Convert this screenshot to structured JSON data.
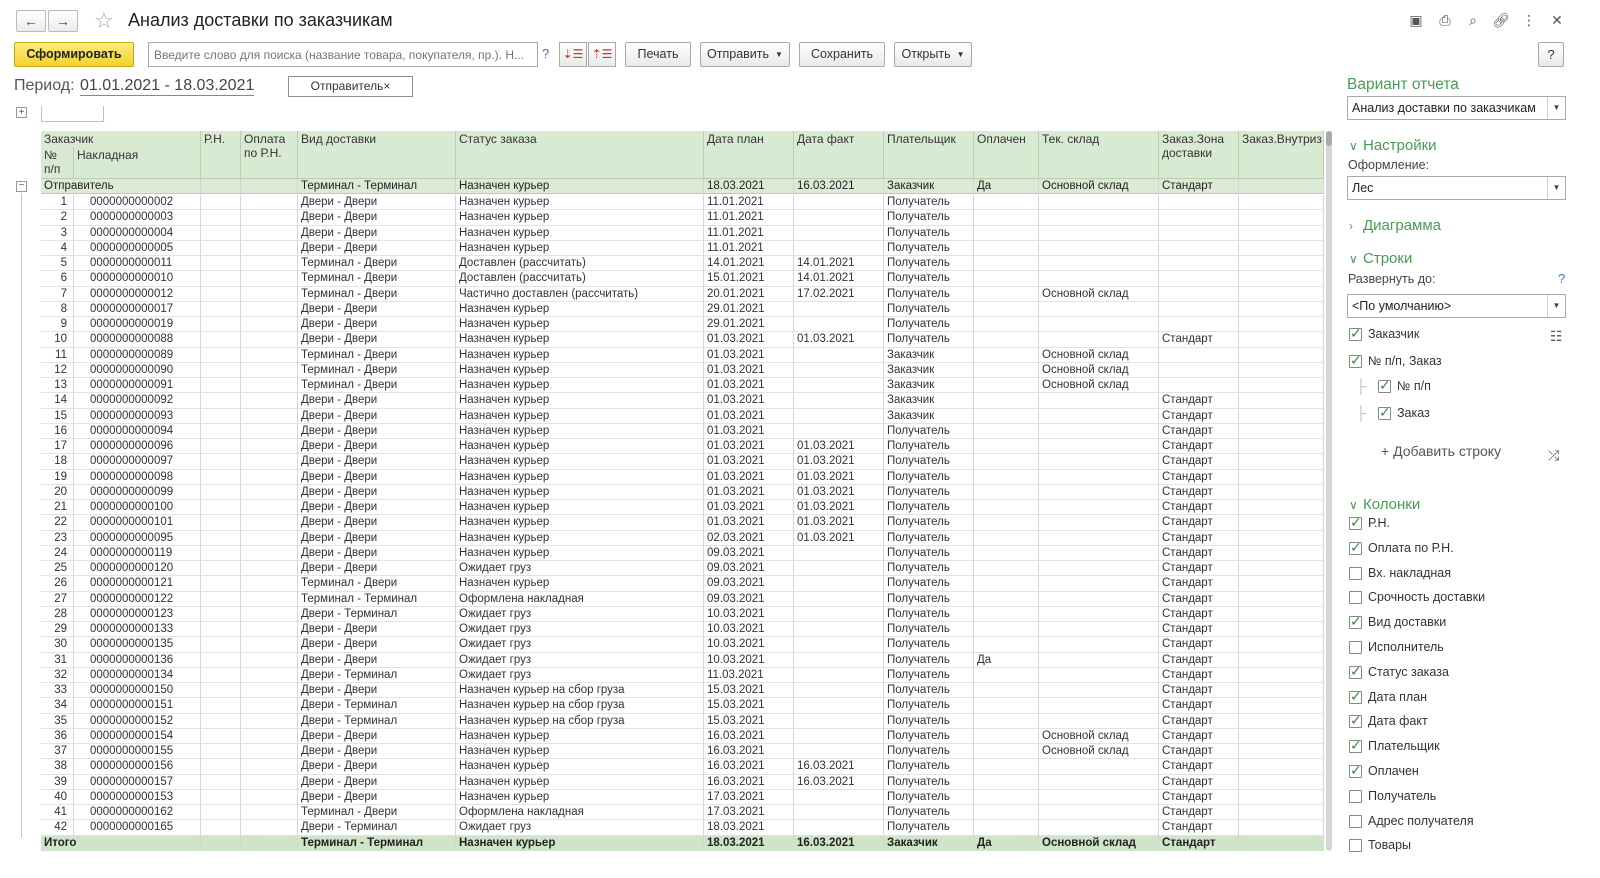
{
  "window": {
    "title": "Анализ доставки по заказчикам"
  },
  "toolbar": {
    "generate_label": "Сформировать",
    "search_placeholder": "Введите слово для поиска (название товара, покупателя, пр.). Н...",
    "help_mark": "?",
    "print_label": "Печать",
    "send_label": "Отправить",
    "save_label": "Сохранить",
    "open_label": "Открыть",
    "help_label": "?"
  },
  "header_icons": [
    "save-icon",
    "print-icon",
    "preview-icon",
    "link-icon",
    "more-icon",
    "close-icon"
  ],
  "period": {
    "label": "Период:",
    "value": "01.01.2021 - 18.03.2021"
  },
  "filter_chip": {
    "label": "Отправитель×"
  },
  "report": {
    "columns": {
      "customer": "Заказчик",
      "num": "№ п/п",
      "waybill": "Накладная",
      "rn": "Р.Н.",
      "pay_rn": "Оплата по Р.Н.",
      "delivery_type": "Вид доставки",
      "order_status": "Статус заказа",
      "date_plan": "Дата план",
      "date_fact": "Дата факт",
      "payer": "Плательщик",
      "paid": "Оплачен",
      "warehouse": "Тек. склад",
      "zone": "Заказ.Зона доставки",
      "inner": "Заказ.Внутриз коэфициент"
    },
    "group": {
      "name": "Отправитель",
      "delivery_type": "Терминал - Терминал",
      "order_status": "Назначен курьер",
      "date_plan": "18.03.2021",
      "date_fact": "16.03.2021",
      "payer": "Заказчик",
      "paid": "Да",
      "warehouse": "Основной склад",
      "zone": "Стандарт"
    },
    "rows": [
      [
        "1",
        "0000000000002",
        "Двери - Двери",
        "Назначен курьер",
        "11.01.2021",
        "",
        "Получатель",
        "",
        "",
        ""
      ],
      [
        "2",
        "0000000000003",
        "Двери - Двери",
        "Назначен курьер",
        "11.01.2021",
        "",
        "Получатель",
        "",
        "",
        ""
      ],
      [
        "3",
        "0000000000004",
        "Двери - Двери",
        "Назначен курьер",
        "11.01.2021",
        "",
        "Получатель",
        "",
        "",
        ""
      ],
      [
        "4",
        "0000000000005",
        "Двери - Двери",
        "Назначен курьер",
        "11.01.2021",
        "",
        "Получатель",
        "",
        "",
        ""
      ],
      [
        "5",
        "0000000000011",
        "Терминал - Двери",
        "Доставлен (рассчитать)",
        "14.01.2021",
        "14.01.2021",
        "Получатель",
        "",
        "",
        ""
      ],
      [
        "6",
        "0000000000010",
        "Терминал - Двери",
        "Доставлен (рассчитать)",
        "15.01.2021",
        "14.01.2021",
        "Получатель",
        "",
        "",
        ""
      ],
      [
        "7",
        "0000000000012",
        "Терминал - Двери",
        "Частично доставлен (рассчитать)",
        "20.01.2021",
        "17.02.2021",
        "Получатель",
        "",
        "Основной склад",
        ""
      ],
      [
        "8",
        "0000000000017",
        "Двери - Двери",
        "Назначен курьер",
        "29.01.2021",
        "",
        "Получатель",
        "",
        "",
        ""
      ],
      [
        "9",
        "0000000000019",
        "Двери - Двери",
        "Назначен курьер",
        "29.01.2021",
        "",
        "Получатель",
        "",
        "",
        ""
      ],
      [
        "10",
        "0000000000088",
        "Двери - Двери",
        "Назначен курьер",
        "01.03.2021",
        "01.03.2021",
        "Получатель",
        "",
        "",
        "Стандарт"
      ],
      [
        "11",
        "0000000000089",
        "Терминал - Двери",
        "Назначен курьер",
        "01.03.2021",
        "",
        "Заказчик",
        "",
        "Основной склад",
        ""
      ],
      [
        "12",
        "0000000000090",
        "Терминал - Двери",
        "Назначен курьер",
        "01.03.2021",
        "",
        "Заказчик",
        "",
        "Основной склад",
        ""
      ],
      [
        "13",
        "0000000000091",
        "Терминал - Двери",
        "Назначен курьер",
        "01.03.2021",
        "",
        "Заказчик",
        "",
        "Основной склад",
        ""
      ],
      [
        "14",
        "0000000000092",
        "Двери - Двери",
        "Назначен курьер",
        "01.03.2021",
        "",
        "Заказчик",
        "",
        "",
        "Стандарт"
      ],
      [
        "15",
        "0000000000093",
        "Двери - Двери",
        "Назначен курьер",
        "01.03.2021",
        "",
        "Заказчик",
        "",
        "",
        "Стандарт"
      ],
      [
        "16",
        "0000000000094",
        "Двери - Двери",
        "Назначен курьер",
        "01.03.2021",
        "",
        "Получатель",
        "",
        "",
        "Стандарт"
      ],
      [
        "17",
        "0000000000096",
        "Двери - Двери",
        "Назначен курьер",
        "01.03.2021",
        "01.03.2021",
        "Получатель",
        "",
        "",
        "Стандарт"
      ],
      [
        "18",
        "0000000000097",
        "Двери - Двери",
        "Назначен курьер",
        "01.03.2021",
        "01.03.2021",
        "Получатель",
        "",
        "",
        "Стандарт"
      ],
      [
        "19",
        "0000000000098",
        "Двери - Двери",
        "Назначен курьер",
        "01.03.2021",
        "01.03.2021",
        "Получатель",
        "",
        "",
        "Стандарт"
      ],
      [
        "20",
        "0000000000099",
        "Двери - Двери",
        "Назначен курьер",
        "01.03.2021",
        "01.03.2021",
        "Получатель",
        "",
        "",
        "Стандарт"
      ],
      [
        "21",
        "0000000000100",
        "Двери - Двери",
        "Назначен курьер",
        "01.03.2021",
        "01.03.2021",
        "Получатель",
        "",
        "",
        "Стандарт"
      ],
      [
        "22",
        "0000000000101",
        "Двери - Двери",
        "Назначен курьер",
        "01.03.2021",
        "01.03.2021",
        "Получатель",
        "",
        "",
        "Стандарт"
      ],
      [
        "23",
        "0000000000095",
        "Двери - Двери",
        "Назначен курьер",
        "02.03.2021",
        "01.03.2021",
        "Получатель",
        "",
        "",
        "Стандарт"
      ],
      [
        "24",
        "0000000000119",
        "Двери - Двери",
        "Назначен курьер",
        "09.03.2021",
        "",
        "Получатель",
        "",
        "",
        "Стандарт"
      ],
      [
        "25",
        "0000000000120",
        "Двери - Двери",
        "Ожидает груз",
        "09.03.2021",
        "",
        "Получатель",
        "",
        "",
        "Стандарт"
      ],
      [
        "26",
        "0000000000121",
        "Терминал - Двери",
        "Назначен курьер",
        "09.03.2021",
        "",
        "Получатель",
        "",
        "",
        "Стандарт"
      ],
      [
        "27",
        "0000000000122",
        "Терминал - Терминал",
        "Оформлена накладная",
        "09.03.2021",
        "",
        "Получатель",
        "",
        "",
        "Стандарт"
      ],
      [
        "28",
        "0000000000123",
        "Двери - Терминал",
        "Ожидает груз",
        "10.03.2021",
        "",
        "Получатель",
        "",
        "",
        "Стандарт"
      ],
      [
        "29",
        "0000000000133",
        "Двери - Двери",
        "Ожидает груз",
        "10.03.2021",
        "",
        "Получатель",
        "",
        "",
        "Стандарт"
      ],
      [
        "30",
        "0000000000135",
        "Двери - Двери",
        "Ожидает груз",
        "10.03.2021",
        "",
        "Получатель",
        "",
        "",
        "Стандарт"
      ],
      [
        "31",
        "0000000000136",
        "Двери - Двери",
        "Ожидает груз",
        "10.03.2021",
        "",
        "Получатель",
        "Да",
        "",
        "Стандарт"
      ],
      [
        "32",
        "0000000000134",
        "Двери - Терминал",
        "Ожидает груз",
        "11.03.2021",
        "",
        "Получатель",
        "",
        "",
        "Стандарт"
      ],
      [
        "33",
        "0000000000150",
        "Двери - Двери",
        "Назначен курьер на сбор груза",
        "15.03.2021",
        "",
        "Получатель",
        "",
        "",
        "Стандарт"
      ],
      [
        "34",
        "0000000000151",
        "Двери - Терминал",
        "Назначен курьер на сбор груза",
        "15.03.2021",
        "",
        "Получатель",
        "",
        "",
        "Стандарт"
      ],
      [
        "35",
        "0000000000152",
        "Двери - Терминал",
        "Назначен курьер на сбор груза",
        "15.03.2021",
        "",
        "Получатель",
        "",
        "",
        "Стандарт"
      ],
      [
        "36",
        "0000000000154",
        "Двери - Двери",
        "Назначен курьер",
        "16.03.2021",
        "",
        "Получатель",
        "",
        "Основной склад",
        "Стандарт"
      ],
      [
        "37",
        "0000000000155",
        "Двери - Двери",
        "Назначен курьер",
        "16.03.2021",
        "",
        "Получатель",
        "",
        "Основной склад",
        "Стандарт"
      ],
      [
        "38",
        "0000000000156",
        "Двери - Двери",
        "Назначен курьер",
        "16.03.2021",
        "16.03.2021",
        "Получатель",
        "",
        "",
        "Стандарт"
      ],
      [
        "39",
        "0000000000157",
        "Двери - Двери",
        "Назначен курьер",
        "16.03.2021",
        "16.03.2021",
        "Получатель",
        "",
        "",
        "Стандарт"
      ],
      [
        "40",
        "0000000000153",
        "Двери - Двери",
        "Назначен курьер",
        "17.03.2021",
        "",
        "Получатель",
        "",
        "",
        "Стандарт"
      ],
      [
        "41",
        "0000000000162",
        "Терминал - Двери",
        "Оформлена накладная",
        "17.03.2021",
        "",
        "Получатель",
        "",
        "",
        "Стандарт"
      ],
      [
        "42",
        "0000000000165",
        "Двери - Терминал",
        "Ожидает груз",
        "18.03.2021",
        "",
        "Получатель",
        "",
        "",
        "Стандарт"
      ]
    ],
    "total": {
      "label": "Итого",
      "delivery_type": "Терминал - Терминал",
      "order_status": "Назначен курьер",
      "date_plan": "18.03.2021",
      "date_fact": "16.03.2021",
      "payer": "Заказчик",
      "paid": "Да",
      "warehouse": "Основной склад",
      "zone": "Стандарт"
    }
  },
  "panel": {
    "variant_title": "Вариант отчета",
    "variant_value": "Анализ доставки по заказчикам",
    "settings_title": "Настройки",
    "design_label": "Оформление:",
    "design_value": "Лес",
    "diagram_title": "Диаграмма",
    "rows_title": "Строки",
    "expand_label": "Развернуть до:",
    "expand_help": "?",
    "expand_value": "<По умолчанию>",
    "row_items": [
      {
        "label": "Заказчик",
        "checked": true
      },
      {
        "label": "№ п/п, Заказ",
        "checked": true
      },
      {
        "label": "№ п/п",
        "checked": true
      },
      {
        "label": "Заказ",
        "checked": true
      }
    ],
    "add_row": "+ Добавить строку",
    "columns_title": "Колонки",
    "column_items": [
      {
        "label": "Р.Н.",
        "checked": true
      },
      {
        "label": "Оплата по Р.Н.",
        "checked": true
      },
      {
        "label": "Вх. накладная",
        "checked": false
      },
      {
        "label": "Срочность доставки",
        "checked": false
      },
      {
        "label": "Вид доставки",
        "checked": true
      },
      {
        "label": "Исполнитель",
        "checked": false
      },
      {
        "label": "Статус заказа",
        "checked": true
      },
      {
        "label": "Дата план",
        "checked": true
      },
      {
        "label": "Дата факт",
        "checked": true
      },
      {
        "label": "Плательщик",
        "checked": true
      },
      {
        "label": "Оплачен",
        "checked": true
      },
      {
        "label": "Получатель",
        "checked": false
      },
      {
        "label": "Адрес получателя",
        "checked": false
      },
      {
        "label": "Товары",
        "checked": false
      }
    ]
  },
  "colors": {
    "accent_green": "#4a9a57",
    "header_bg": "#d9ead3",
    "primary_button": "#f4d12b"
  }
}
